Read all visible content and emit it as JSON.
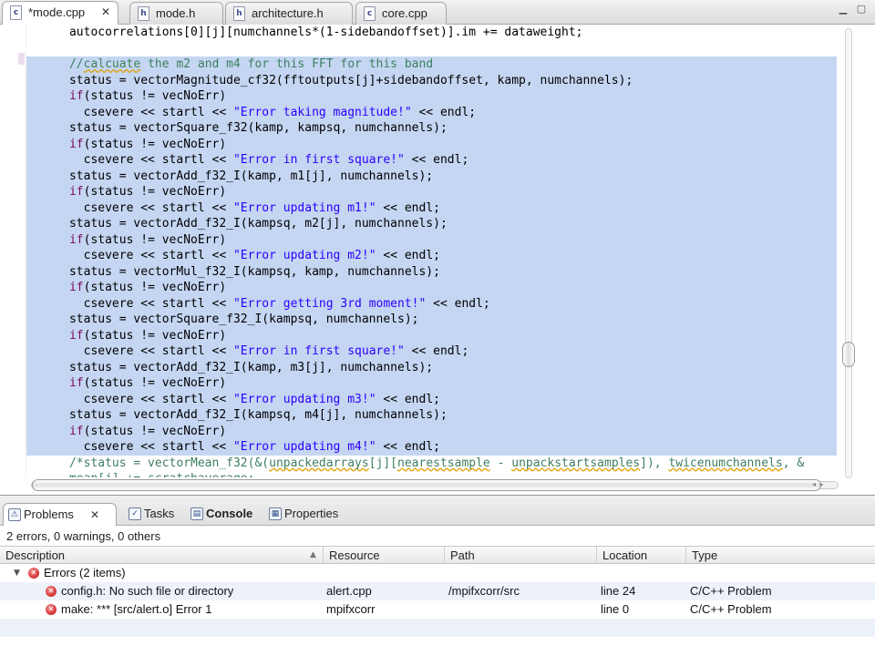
{
  "editor_tabs": [
    {
      "label": "*mode.cpp",
      "icon": "c-source-file-icon",
      "icon_glyph": "c",
      "active": true
    },
    {
      "label": "mode.h",
      "icon": "header-file-icon",
      "icon_glyph": "h",
      "active": false
    },
    {
      "label": "architecture.h",
      "icon": "header-file-icon",
      "icon_glyph": "h",
      "active": false
    },
    {
      "label": "core.cpp",
      "icon": "c-source-file-icon",
      "icon_glyph": "c",
      "active": false
    }
  ],
  "tab_close_glyph": "✕",
  "window_controls": {
    "minimize": "▁",
    "maximize": "▢"
  },
  "code_lines": [
    {
      "sel": false,
      "parts": [
        {
          "t": "      autocorrelations[0][j][numchannels*(1-sidebandoffset)].im += dataweight;",
          "c": ""
        }
      ]
    },
    {
      "sel": false,
      "parts": [
        {
          "t": "",
          "c": ""
        }
      ]
    },
    {
      "sel": true,
      "parts": [
        {
          "t": "      ",
          "c": ""
        },
        {
          "t": "//",
          "c": "cmt"
        },
        {
          "t": "calcuate",
          "c": "cmt sq"
        },
        {
          "t": " the m2 and m4 for this FFT for this band",
          "c": "cmt"
        }
      ]
    },
    {
      "sel": true,
      "parts": [
        {
          "t": "      status = vectorMagnitude_cf32(fftoutputs[j]+sidebandoffset, kamp, numchannels);",
          "c": ""
        }
      ]
    },
    {
      "sel": true,
      "parts": [
        {
          "t": "      ",
          "c": ""
        },
        {
          "t": "if",
          "c": "kw"
        },
        {
          "t": "(status != vecNoErr)",
          "c": ""
        }
      ]
    },
    {
      "sel": true,
      "parts": [
        {
          "t": "        csevere << startl << ",
          "c": ""
        },
        {
          "t": "\"Error taking magnitude!\"",
          "c": "str"
        },
        {
          "t": " << endl;",
          "c": ""
        }
      ]
    },
    {
      "sel": true,
      "parts": [
        {
          "t": "      status = vectorSquare_f32(kamp, kampsq, numchannels);",
          "c": ""
        }
      ]
    },
    {
      "sel": true,
      "parts": [
        {
          "t": "      ",
          "c": ""
        },
        {
          "t": "if",
          "c": "kw"
        },
        {
          "t": "(status != vecNoErr)",
          "c": ""
        }
      ]
    },
    {
      "sel": true,
      "parts": [
        {
          "t": "        csevere << startl << ",
          "c": ""
        },
        {
          "t": "\"Error in first square!\"",
          "c": "str"
        },
        {
          "t": " << endl;",
          "c": ""
        }
      ]
    },
    {
      "sel": true,
      "parts": [
        {
          "t": "      status = vectorAdd_f32_I(kamp, m1[j], numchannels);",
          "c": ""
        }
      ]
    },
    {
      "sel": true,
      "parts": [
        {
          "t": "      ",
          "c": ""
        },
        {
          "t": "if",
          "c": "kw"
        },
        {
          "t": "(status != vecNoErr)",
          "c": ""
        }
      ]
    },
    {
      "sel": true,
      "parts": [
        {
          "t": "        csevere << startl << ",
          "c": ""
        },
        {
          "t": "\"Error updating m1!\"",
          "c": "str"
        },
        {
          "t": " << endl;",
          "c": ""
        }
      ]
    },
    {
      "sel": true,
      "parts": [
        {
          "t": "      status = vectorAdd_f32_I(kampsq, m2[j], numchannels);",
          "c": ""
        }
      ]
    },
    {
      "sel": true,
      "parts": [
        {
          "t": "      ",
          "c": ""
        },
        {
          "t": "if",
          "c": "kw"
        },
        {
          "t": "(status != vecNoErr)",
          "c": ""
        }
      ]
    },
    {
      "sel": true,
      "parts": [
        {
          "t": "        csevere << startl << ",
          "c": ""
        },
        {
          "t": "\"Error updating m2!\"",
          "c": "str"
        },
        {
          "t": " << endl;",
          "c": ""
        }
      ]
    },
    {
      "sel": true,
      "parts": [
        {
          "t": "      status = vectorMul_f32_I(kampsq, kamp, numchannels);",
          "c": ""
        }
      ]
    },
    {
      "sel": true,
      "parts": [
        {
          "t": "      ",
          "c": ""
        },
        {
          "t": "if",
          "c": "kw"
        },
        {
          "t": "(status != vecNoErr)",
          "c": ""
        }
      ]
    },
    {
      "sel": true,
      "parts": [
        {
          "t": "        csevere << startl << ",
          "c": ""
        },
        {
          "t": "\"Error getting 3rd moment!\"",
          "c": "str"
        },
        {
          "t": " << endl;",
          "c": ""
        }
      ]
    },
    {
      "sel": true,
      "parts": [
        {
          "t": "      status = vectorSquare_f32_I(kampsq, numchannels);",
          "c": ""
        }
      ]
    },
    {
      "sel": true,
      "parts": [
        {
          "t": "      ",
          "c": ""
        },
        {
          "t": "if",
          "c": "kw"
        },
        {
          "t": "(status != vecNoErr)",
          "c": ""
        }
      ]
    },
    {
      "sel": true,
      "parts": [
        {
          "t": "        csevere << startl << ",
          "c": ""
        },
        {
          "t": "\"Error in first square!\"",
          "c": "str"
        },
        {
          "t": " << endl;",
          "c": ""
        }
      ]
    },
    {
      "sel": true,
      "parts": [
        {
          "t": "      status = vectorAdd_f32_I(kamp, m3[j], numchannels);",
          "c": ""
        }
      ]
    },
    {
      "sel": true,
      "parts": [
        {
          "t": "      ",
          "c": ""
        },
        {
          "t": "if",
          "c": "kw"
        },
        {
          "t": "(status != vecNoErr)",
          "c": ""
        }
      ]
    },
    {
      "sel": true,
      "parts": [
        {
          "t": "        csevere << startl << ",
          "c": ""
        },
        {
          "t": "\"Error updating m3!\"",
          "c": "str"
        },
        {
          "t": " << endl;",
          "c": ""
        }
      ]
    },
    {
      "sel": true,
      "parts": [
        {
          "t": "      status = vectorAdd_f32_I(kampsq, m4[j], numchannels);",
          "c": ""
        }
      ]
    },
    {
      "sel": true,
      "parts": [
        {
          "t": "      ",
          "c": ""
        },
        {
          "t": "if",
          "c": "kw"
        },
        {
          "t": "(status != vecNoErr)",
          "c": ""
        }
      ]
    },
    {
      "sel": true,
      "parts": [
        {
          "t": "        csevere << startl << ",
          "c": ""
        },
        {
          "t": "\"Error updating m4!\"",
          "c": "str"
        },
        {
          "t": " << endl;",
          "c": ""
        }
      ]
    },
    {
      "sel": false,
      "parts": [
        {
          "t": "      ",
          "c": ""
        },
        {
          "t": "/*status = vectorMean_f32(&(",
          "c": "cmt"
        },
        {
          "t": "unpackedarrays",
          "c": "cmt sq"
        },
        {
          "t": "[j][",
          "c": "cmt"
        },
        {
          "t": "nearestsample",
          "c": "cmt sq"
        },
        {
          "t": " - ",
          "c": "cmt"
        },
        {
          "t": "unpackstartsamples",
          "c": "cmt sq"
        },
        {
          "t": "]), ",
          "c": "cmt"
        },
        {
          "t": "twicenumchannels",
          "c": "cmt sq"
        },
        {
          "t": ", &",
          "c": "cmt"
        }
      ]
    },
    {
      "sel": false,
      "parts": [
        {
          "t": "      mean[j] += ",
          "c": "cmt"
        },
        {
          "t": "scratchaverage",
          "c": "cmt sq"
        },
        {
          "t": ";",
          "c": "cmt"
        }
      ]
    }
  ],
  "panel_tabs": [
    {
      "label": "Problems",
      "icon": "problems-icon",
      "icon_glyph": "⚠",
      "active": true,
      "bold": false
    },
    {
      "label": "Tasks",
      "icon": "tasks-icon",
      "icon_glyph": "✓",
      "active": false,
      "bold": false
    },
    {
      "label": "Console",
      "icon": "console-icon",
      "icon_glyph": "▤",
      "active": false,
      "bold": true
    },
    {
      "label": "Properties",
      "icon": "properties-icon",
      "icon_glyph": "▦",
      "active": false,
      "bold": false
    }
  ],
  "problems": {
    "summary": "2 errors, 0 warnings, 0 others",
    "columns": [
      "Description",
      "Resource",
      "Path",
      "Location",
      "Type"
    ],
    "sort_glyph": "▲",
    "group": {
      "label": "Errors (2 items)",
      "expander": "▼"
    },
    "rows": [
      {
        "description": "config.h: No such file or directory",
        "resource": "alert.cpp",
        "path": "/mpifxcorr/src",
        "location": "line 24",
        "type": "C/C++ Problem"
      },
      {
        "description": "make: *** [src/alert.o] Error 1",
        "resource": "mpifxcorr",
        "path": "",
        "location": "line 0",
        "type": "C/C++ Problem"
      }
    ]
  },
  "colors": {
    "selection": "#c4d6f2",
    "keyword": "#7b0f55",
    "string": "#2a00ff",
    "comment": "#3f7f5f",
    "error": "#d83a3a"
  },
  "scroll_arrows": {
    "up": "▲",
    "down": "▼",
    "horizontal": "◂ ▸"
  }
}
